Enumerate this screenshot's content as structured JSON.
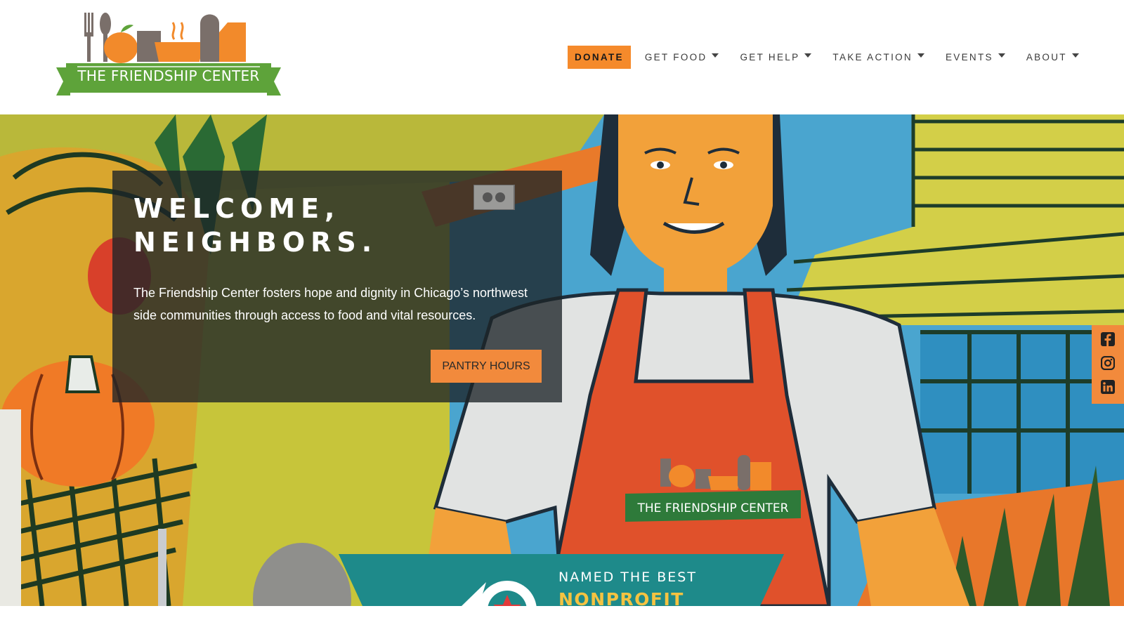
{
  "header": {
    "logo_text": "THE FRIENDSHIP CENTER",
    "nav": {
      "donate": "DONATE",
      "items": [
        {
          "label": "GET FOOD"
        },
        {
          "label": "GET HELP"
        },
        {
          "label": "TAKE ACTION"
        },
        {
          "label": "EVENTS"
        },
        {
          "label": "ABOUT"
        }
      ]
    }
  },
  "hero": {
    "title_line1": "WELCOME,",
    "title_line2": "NEIGHBORS.",
    "body": "The Friendship Center fosters hope and dignity in Chicago’s northwest side communities through access to food and vital resources.",
    "button": "PANTRY HOURS",
    "apron_logo_text": "THE FRIENDSHIP CENTER",
    "banner_line1": "NAMED THE BEST",
    "banner_line2": "NONPROFIT"
  },
  "social": {
    "icons": [
      "facebook-icon",
      "instagram-icon",
      "linkedin-icon"
    ]
  },
  "colors": {
    "accent_orange": "#f58a2b",
    "logo_green": "#5ea33a",
    "banner_teal": "#1e8a8a"
  }
}
